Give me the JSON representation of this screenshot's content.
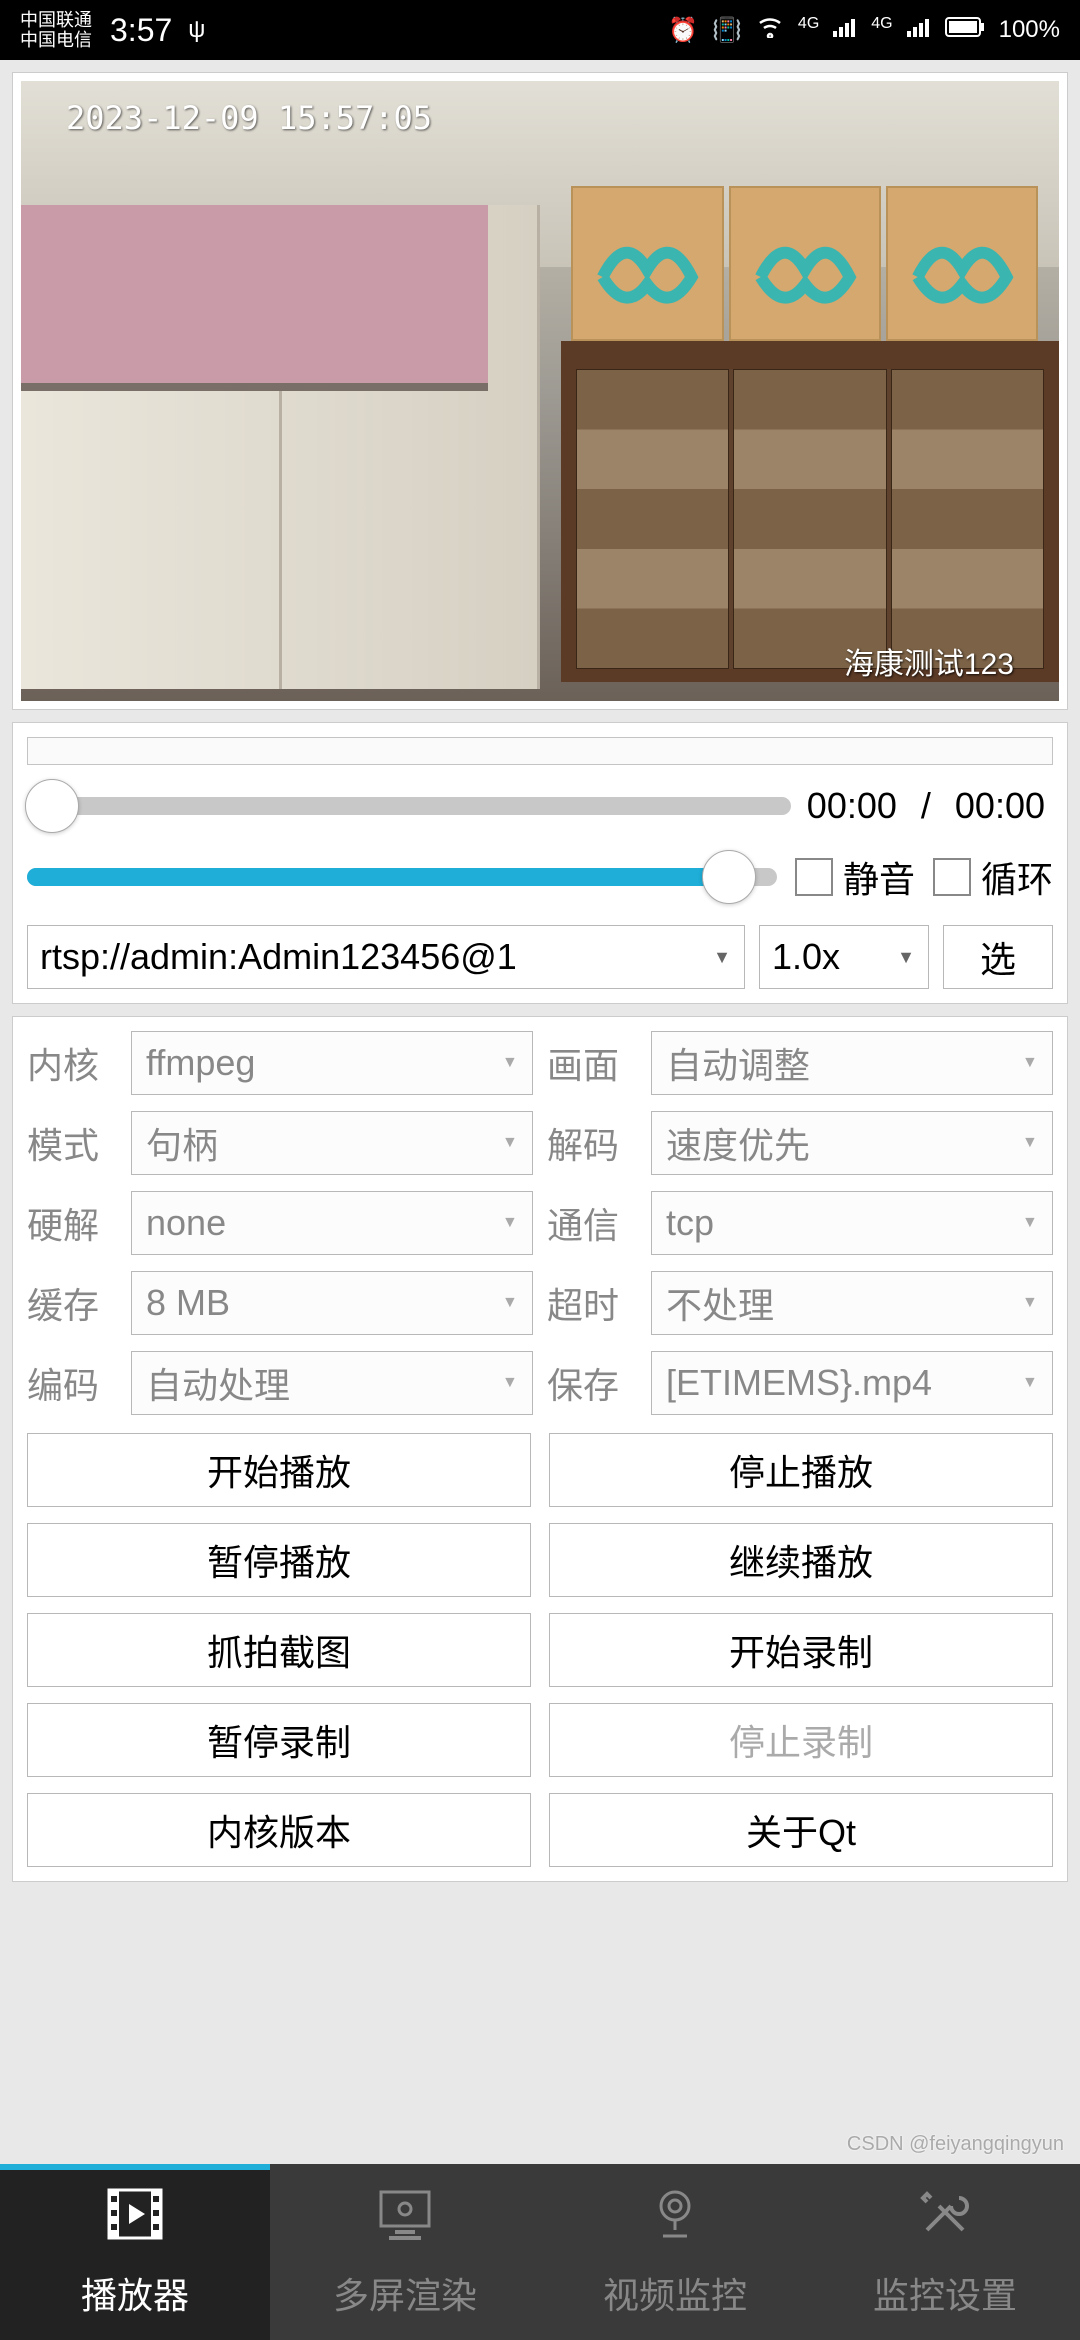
{
  "statusbar": {
    "carrier1": "中国联通",
    "carrier2": "中国电信",
    "time": "3:57",
    "battery": "100%",
    "net_label": "4G"
  },
  "video": {
    "timestamp": "2023-12-09 15:57:05",
    "watermark": "海康测试123"
  },
  "player": {
    "current_time": "00:00",
    "separator": "/",
    "total_time": "00:00",
    "mute_label": "静音",
    "loop_label": "循环",
    "url": "rtsp://admin:Admin123456@1",
    "speed": "1.0x",
    "choose": "选"
  },
  "settings": {
    "labels": {
      "kernel": "内核",
      "screen": "画面",
      "mode": "模式",
      "decode": "解码",
      "hw": "硬解",
      "comm": "通信",
      "cache": "缓存",
      "timeout": "超时",
      "encode": "编码",
      "save": "保存"
    },
    "values": {
      "kernel": "ffmpeg",
      "screen": "自动调整",
      "mode": "句柄",
      "decode": "速度优先",
      "hw": "none",
      "comm": "tcp",
      "cache": "8 MB",
      "timeout": "不处理",
      "encode": "自动处理",
      "save": "[ETIMEMS}.mp4"
    }
  },
  "buttons": {
    "play": "开始播放",
    "stop": "停止播放",
    "pause": "暂停播放",
    "resume": "继续播放",
    "snapshot": "抓拍截图",
    "rec_start": "开始录制",
    "rec_pause": "暂停录制",
    "rec_stop": "停止录制",
    "kernel_ver": "内核版本",
    "about_qt": "关于Qt"
  },
  "tabs": {
    "player": "播放器",
    "multi": "多屏渲染",
    "monitor": "视频监控",
    "config": "监控设置"
  },
  "footer_watermark": "CSDN @feiyangqingyun"
}
